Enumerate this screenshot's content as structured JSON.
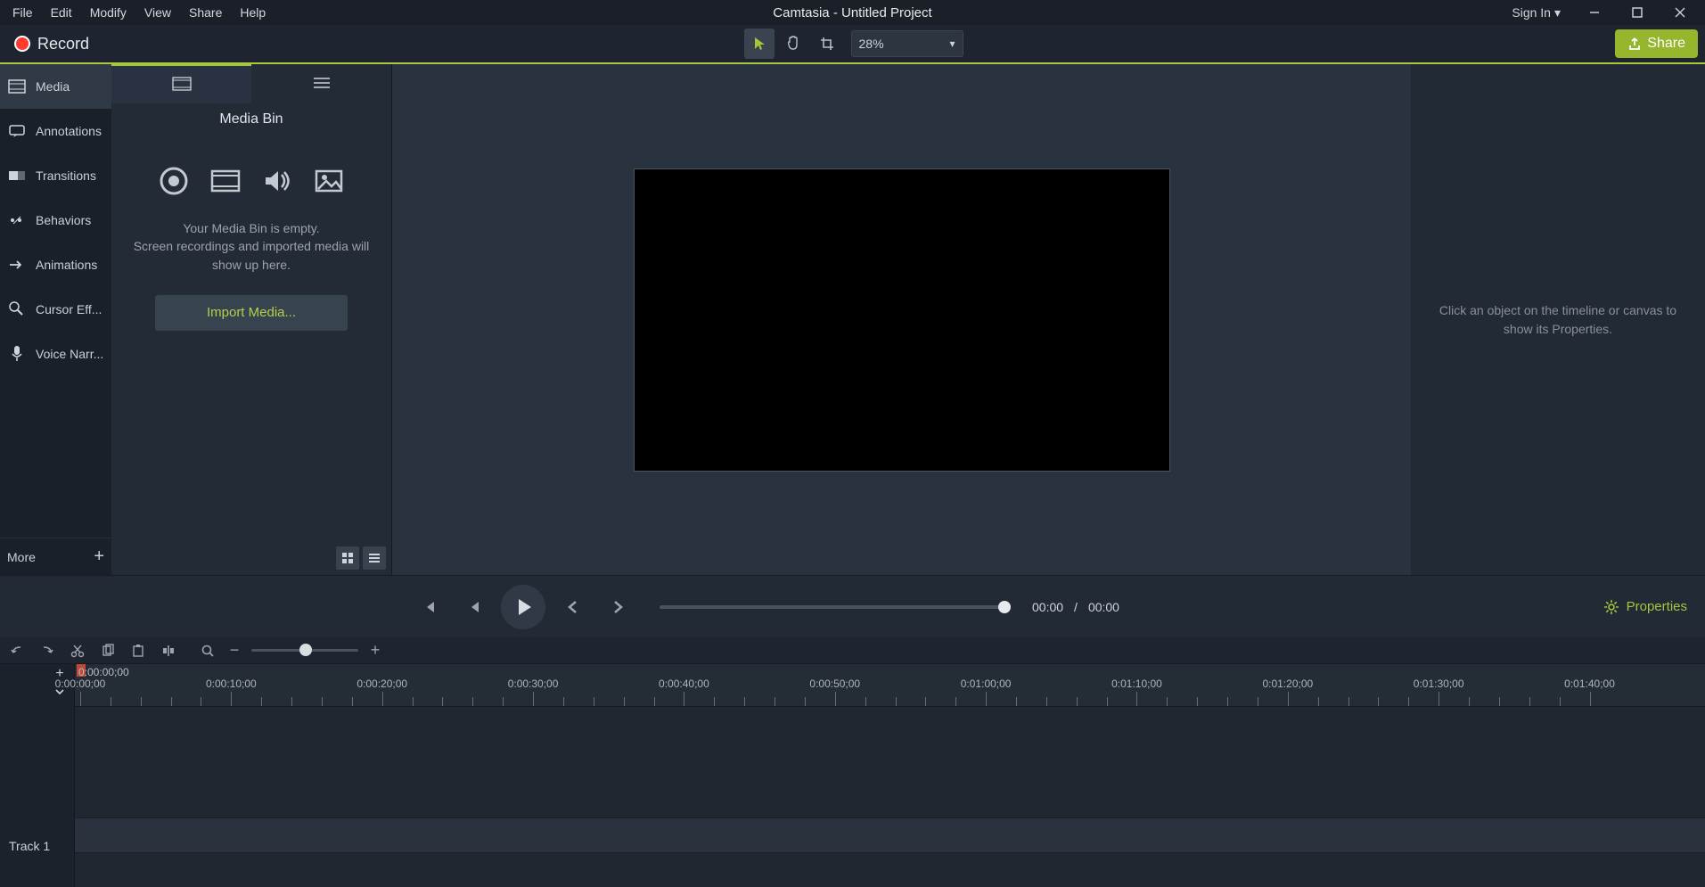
{
  "menubar": {
    "items": [
      "File",
      "Edit",
      "Modify",
      "View",
      "Share",
      "Help"
    ]
  },
  "app_title": "Camtasia - Untitled Project",
  "signin_label": "Sign In",
  "toolbar": {
    "record_label": "Record",
    "zoom_value": "28%",
    "share_label": "Share"
  },
  "sidebar": {
    "items": [
      {
        "label": "Media",
        "icon": "media"
      },
      {
        "label": "Annotations",
        "icon": "annotations"
      },
      {
        "label": "Transitions",
        "icon": "transitions"
      },
      {
        "label": "Behaviors",
        "icon": "behaviors"
      },
      {
        "label": "Animations",
        "icon": "animations"
      },
      {
        "label": "Cursor Eff...",
        "icon": "cursor"
      },
      {
        "label": "Voice Narr...",
        "icon": "voice"
      }
    ],
    "more_label": "More"
  },
  "panel": {
    "title": "Media Bin",
    "empty_msg": "Your Media Bin is empty.\nScreen recordings and imported media will show up here.",
    "import_label": "Import Media..."
  },
  "properties_placeholder": "Click an object on the timeline or canvas to show its Properties.",
  "playback": {
    "cur": "00:00",
    "sep": "/",
    "dur": "00:00",
    "props_label": "Properties"
  },
  "timeline": {
    "playhead_time": "0:00:00;00",
    "track_label": "Track 1",
    "ruler_labels": [
      "0:00:00;00",
      "0:00:10;00",
      "0:00:20;00",
      "0:00:30;00",
      "0:00:40;00",
      "0:00:50;00",
      "0:01:00;00",
      "0:01:10;00",
      "0:01:20;00",
      "0:01:30;00",
      "0:01:40;00"
    ]
  }
}
